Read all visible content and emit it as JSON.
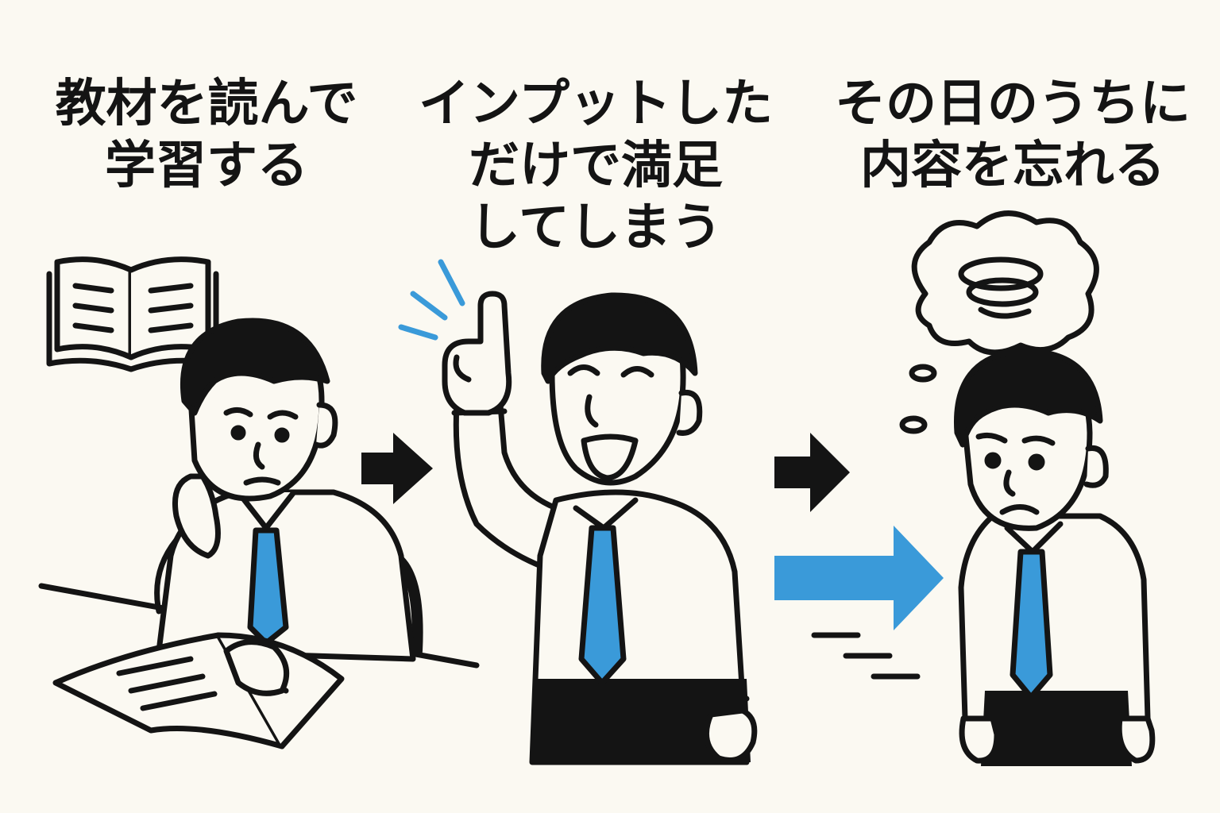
{
  "colors": {
    "background": "#fbf9f2",
    "ink": "#141414",
    "accent_blue": "#3a9ad9"
  },
  "panels": [
    {
      "caption_lines": [
        "教材を読んで",
        "学習する"
      ]
    },
    {
      "caption_lines": [
        "インプットした",
        "だけで満足",
        "してしまう"
      ]
    },
    {
      "caption_lines": [
        "その日のうちに",
        "内容を忘れる"
      ]
    }
  ],
  "icons": {
    "arrow_1": "right-arrow-icon",
    "arrow_2": "right-arrow-icon",
    "arrow_3": "right-arrow-icon",
    "book": "open-book-icon",
    "thought": "thought-bubble-icon"
  }
}
